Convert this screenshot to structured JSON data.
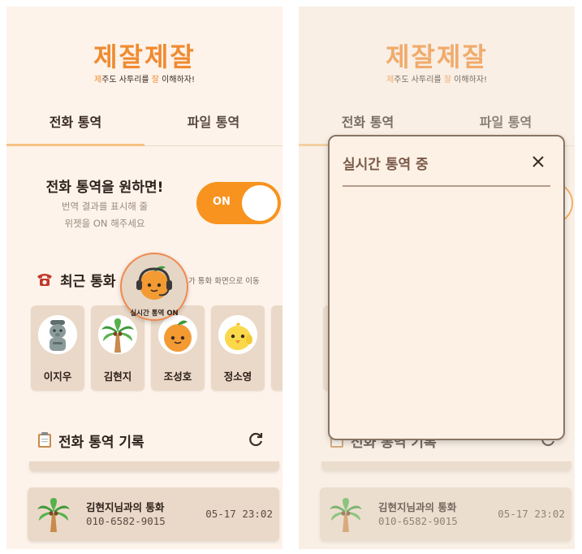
{
  "app": {
    "logo_title": "제잘제잘",
    "logo_sub_parts": [
      "제",
      "주도 사투리를 ",
      "잘",
      " 이해하자!"
    ]
  },
  "tabs": [
    {
      "label": "전화 통역"
    },
    {
      "label": "파일 통역"
    }
  ],
  "promo": {
    "title": "전화 통역을 원하면!",
    "desc_line1": "번역 결과를 표시해 줄",
    "desc_line2": "위젯을 ON 해주세요",
    "toggle_label": "ON"
  },
  "recent": {
    "title": "최근 통화",
    "hint": "가 통화 화면으로 이동"
  },
  "floating_badge": {
    "label": "실시간 통역 ON"
  },
  "contacts": [
    {
      "name": "이지우",
      "icon": "dolhareubang-icon"
    },
    {
      "name": "김현지",
      "icon": "palm-tree-icon"
    },
    {
      "name": "조성호",
      "icon": "tangerine-icon"
    },
    {
      "name": "정소영",
      "icon": "chick-icon"
    }
  ],
  "history": {
    "title": "전화 통역 기록",
    "records": [
      {
        "name": "김현지님과의 통화",
        "phone": "010-6582-9015",
        "time": "05-17 23:02"
      }
    ]
  },
  "modal": {
    "title": "실시간 통역 중"
  },
  "colors": {
    "accent": "#f7931e",
    "background": "#fdf3ea",
    "card": "#ead9c8",
    "modal_border": "#8a7464"
  }
}
